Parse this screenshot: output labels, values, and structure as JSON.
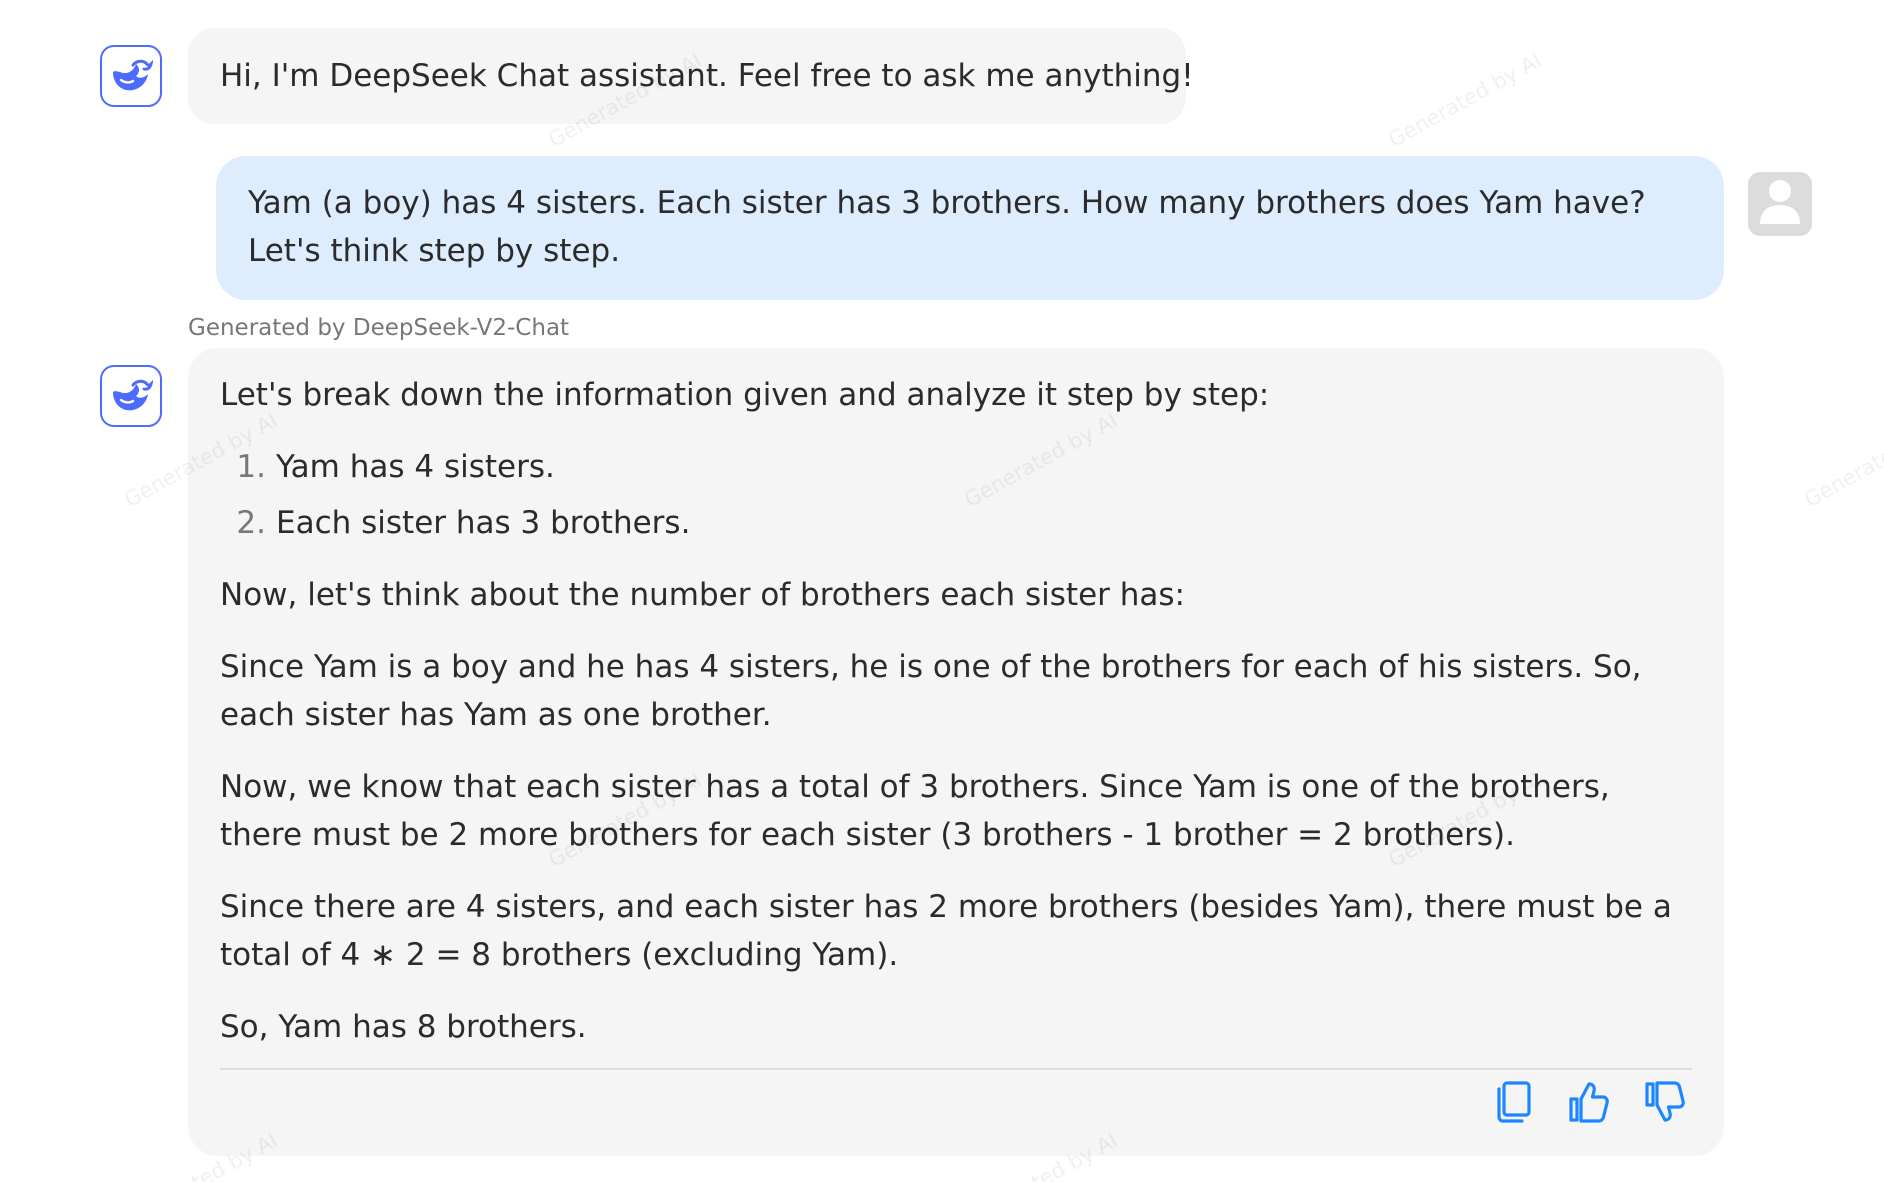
{
  "colors": {
    "accent": "#4d6bfe",
    "action_blue": "#1b86ff",
    "user_bubble": "#deedfd",
    "bot_bubble": "#f5f5f5"
  },
  "watermark": "Generated by AI",
  "greeting": {
    "avatar_icon": "deepseek-whale-icon",
    "text": "Hi, I'm DeepSeek Chat assistant. Feel free to ask me anything!"
  },
  "user_message": {
    "avatar_icon": "user-silhouette-icon",
    "text": "Yam (a boy) has 4 sisters. Each sister has 3 brothers. How many brothers does Yam have? Let's think step by step."
  },
  "response": {
    "model_label": "Generated by DeepSeek-V2-Chat",
    "avatar_icon": "deepseek-whale-icon",
    "intro": "Let's break down the information given and analyze it step by step:",
    "list": [
      {
        "num": "1.",
        "text": "Yam has 4 sisters."
      },
      {
        "num": "2.",
        "text": "Each sister has 3 brothers."
      }
    ],
    "paragraphs": [
      "Now, let's think about the number of brothers each sister has:",
      "Since Yam is a boy and he has 4 sisters, he is one of the brothers for each of his sisters. So, each sister has Yam as one brother.",
      "Now, we know that each sister has a total of 3 brothers. Since Yam is one of the brothers, there must be 2 more brothers for each sister (3 brothers - 1 brother = 2 brothers).",
      "Since there are 4 sisters, and each sister has 2 more brothers (besides Yam), there must be a total of 4 ∗ 2 = 8 brothers (excluding Yam).",
      "So, Yam has 8 brothers."
    ],
    "actions": [
      {
        "name": "copy-icon"
      },
      {
        "name": "thumbs-up-icon"
      },
      {
        "name": "thumbs-down-icon"
      }
    ]
  }
}
